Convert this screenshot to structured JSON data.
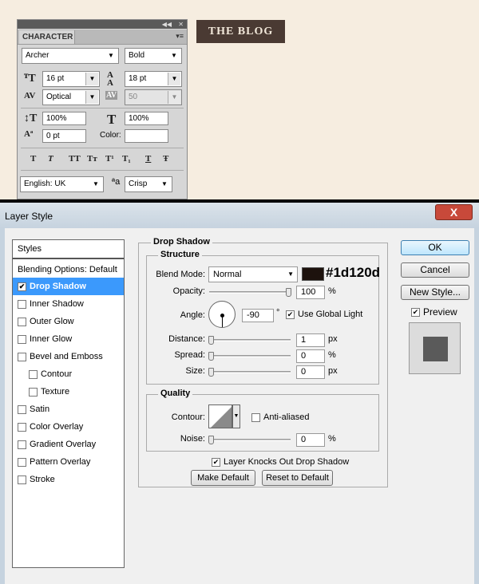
{
  "character_panel": {
    "tab_title": "CHARACTER",
    "collapse_glyph": "◀◀",
    "close_glyph": "✕",
    "menu_glyph": "▾≡",
    "font_family": "Archer",
    "font_style": "Bold",
    "font_size": "16 pt",
    "leading": "18 pt",
    "kerning": "Optical",
    "tracking": "50",
    "vertical_scale": "100%",
    "horizontal_scale": "100%",
    "baseline_shift": "0 pt",
    "color_label": "Color:",
    "color_value": "#ffffff",
    "language": "English: UK",
    "antialias": "Crisp",
    "style_buttons": [
      "T",
      "T",
      "TT",
      "Tт",
      "T¹",
      "T₁",
      "T",
      "Ŧ"
    ]
  },
  "blog_label": "THE BLOG",
  "layer_style": {
    "title": "Layer Style",
    "close_glyph": "X",
    "styles_header": "Styles",
    "blending_options": "Blending Options: Default",
    "items": [
      {
        "label": "Drop Shadow",
        "checked": true,
        "selected": true
      },
      {
        "label": "Inner Shadow",
        "checked": false
      },
      {
        "label": "Outer Glow",
        "checked": false
      },
      {
        "label": "Inner Glow",
        "checked": false
      },
      {
        "label": "Bevel and Emboss",
        "checked": false
      },
      {
        "label": "Contour",
        "checked": false
      },
      {
        "label": "Texture",
        "checked": false
      },
      {
        "label": "Satin",
        "checked": false
      },
      {
        "label": "Color Overlay",
        "checked": false
      },
      {
        "label": "Gradient Overlay",
        "checked": false
      },
      {
        "label": "Pattern Overlay",
        "checked": false
      },
      {
        "label": "Stroke",
        "checked": false
      }
    ],
    "section_title": "Drop Shadow",
    "structure": {
      "title": "Structure",
      "blend_mode_label": "Blend Mode:",
      "blend_mode": "Normal",
      "shadow_color": "#1d120d",
      "shadow_color_label": "#1d120d",
      "opacity_label": "Opacity:",
      "opacity": "100",
      "opacity_fraction": 1.0,
      "angle_label": "Angle:",
      "angle": "-90",
      "degree": "°",
      "use_global_light_label": "Use Global Light",
      "use_global_light": true,
      "distance_label": "Distance:",
      "distance": "1",
      "spread_label": "Spread:",
      "spread": "0",
      "size_label": "Size:",
      "size": "0",
      "px": "px",
      "percent": "%"
    },
    "quality": {
      "title": "Quality",
      "contour_label": "Contour:",
      "anti_aliased_label": "Anti-aliased",
      "anti_aliased": false,
      "noise_label": "Noise:",
      "noise": "0",
      "percent": "%"
    },
    "knocks_out_label": "Layer Knocks Out Drop Shadow",
    "knocks_out": true,
    "make_default": "Make Default",
    "reset_to_default": "Reset to Default",
    "ok": "OK",
    "cancel": "Cancel",
    "new_style": "New Style...",
    "preview_label": "Preview",
    "preview_checked": true
  }
}
